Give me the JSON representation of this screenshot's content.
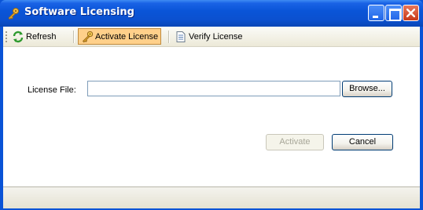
{
  "window": {
    "title": "Software Licensing"
  },
  "toolbar": {
    "refresh_label": "Refresh",
    "activate_license_label": "Activate License",
    "verify_license_label": "Verify License"
  },
  "form": {
    "license_file_label": "License File:",
    "license_file_value": "",
    "browse_label": "Browse...",
    "activate_label": "Activate",
    "cancel_label": "Cancel"
  },
  "icons": {
    "app": "key-icon",
    "refresh": "refresh-icon",
    "activate": "key-icon",
    "verify": "document-icon"
  },
  "colors": {
    "titlebar": "#0a55d8",
    "toolbar_selected": "#ffd08a",
    "close_button": "#c8391a"
  }
}
